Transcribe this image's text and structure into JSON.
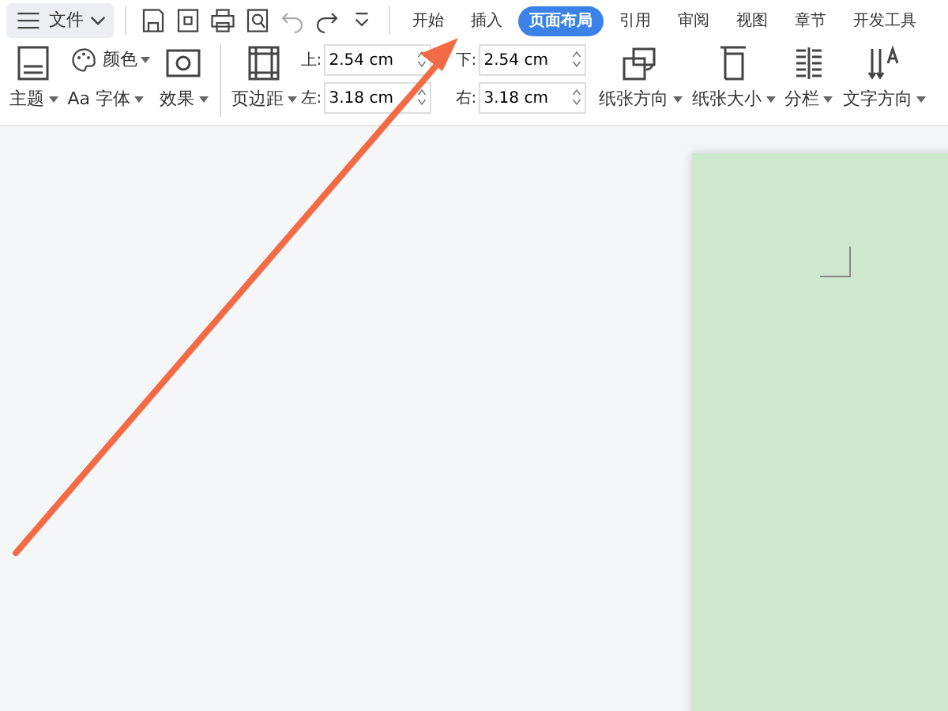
{
  "menu": {
    "label": "文件"
  },
  "tabs": [
    {
      "label": "开始",
      "selected": false
    },
    {
      "label": "插入",
      "selected": false
    },
    {
      "label": "页面布局",
      "selected": true
    },
    {
      "label": "引用",
      "selected": false
    },
    {
      "label": "审阅",
      "selected": false
    },
    {
      "label": "视图",
      "selected": false
    },
    {
      "label": "章节",
      "selected": false
    },
    {
      "label": "开发工具",
      "selected": false
    }
  ],
  "ribbon": {
    "theme": "主题",
    "color_label": "颜色",
    "font_prefix": "Aa",
    "font": "字体",
    "effects": "效果",
    "margins": "页边距",
    "margin_fields": [
      {
        "label": "上:",
        "value": "2.54 cm"
      },
      {
        "label": "下:",
        "value": "2.54 cm"
      },
      {
        "label": "左:",
        "value": "3.18 cm"
      },
      {
        "label": "右:",
        "value": "3.18 cm"
      }
    ],
    "orientation": "纸张方向",
    "size": "纸张大小",
    "columns": "分栏",
    "text_direction": "文字方向"
  }
}
